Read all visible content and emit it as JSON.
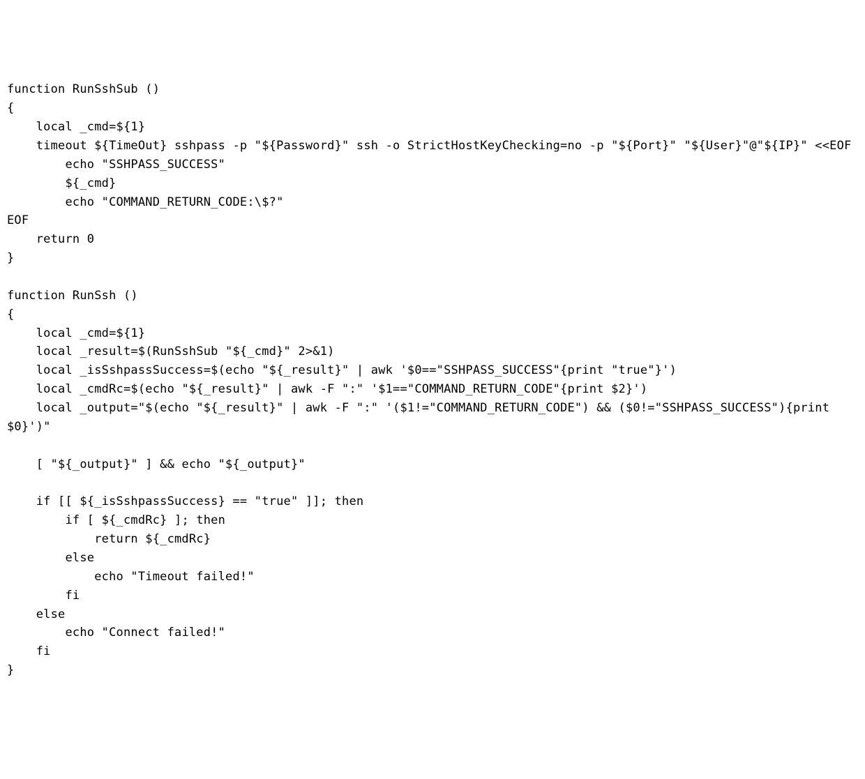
{
  "code": "function RunSshSub ()\n{\n    local _cmd=${1}\n    timeout ${TimeOut} sshpass -p \"${Password}\" ssh -o StrictHostKeyChecking=no -p \"${Port}\" \"${User}\"@\"${IP}\" <<EOF\n        echo \"SSHPASS_SUCCESS\"\n        ${_cmd}\n        echo \"COMMAND_RETURN_CODE:\\$?\"\nEOF\n    return 0\n}\n\nfunction RunSsh ()\n{\n    local _cmd=${1}\n    local _result=$(RunSshSub \"${_cmd}\" 2>&1)\n    local _isSshpassSuccess=$(echo \"${_result}\" | awk '$0==\"SSHPASS_SUCCESS\"{print \"true\"}')\n    local _cmdRc=$(echo \"${_result}\" | awk -F \":\" '$1==\"COMMAND_RETURN_CODE\"{print $2}')\n    local _output=\"$(echo \"${_result}\" | awk -F \":\" '($1!=\"COMMAND_RETURN_CODE\") && ($0!=\"SSHPASS_SUCCESS\"){print $0}')\"\n\n    [ \"${_output}\" ] && echo \"${_output}\"\n\n    if [[ ${_isSshpassSuccess} == \"true\" ]]; then\n        if [ ${_cmdRc} ]; then\n            return ${_cmdRc}\n        else\n            echo \"Timeout failed!\"\n        fi\n    else\n        echo \"Connect failed!\"\n    fi\n}"
}
